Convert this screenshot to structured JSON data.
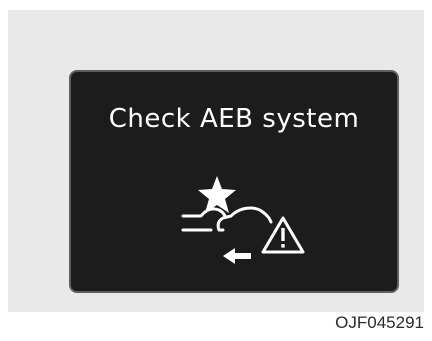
{
  "display": {
    "message": "Check AEB system",
    "icon": "aeb-collision-warning-icon",
    "background_color": "#1c1c1c",
    "text_color": "#ffffff"
  },
  "caption": {
    "code": "OJF045291"
  }
}
